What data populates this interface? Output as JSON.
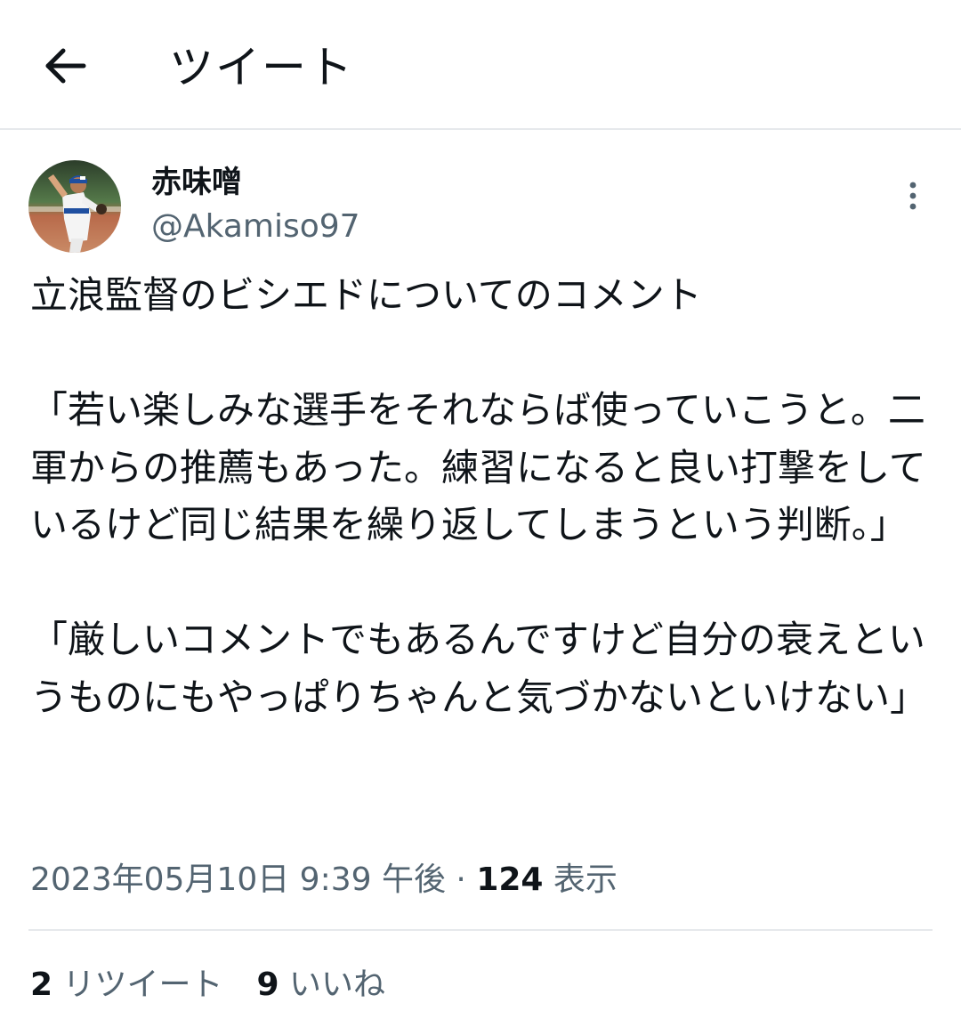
{
  "header": {
    "back_icon": "arrow-left-icon",
    "title": "ツイート"
  },
  "author": {
    "display_name": "赤味噌",
    "handle": "@Akamiso97",
    "avatar_icon": "baseball-pitcher-photo"
  },
  "more_icon": "vertical-ellipsis-icon",
  "tweet": {
    "text": "立浪監督のビシエドについてのコメント\n\n「若い楽しみな選手をそれならば使っていこうと。二軍からの推薦もあった。練習になると良い打撃をしているけど同じ結果を繰り返してしまうという判断。」\n\n「厳しいコメントでもあるんですけど自分の衰えというものにもやっぱりちゃんと気づかないといけない」"
  },
  "meta": {
    "timestamp": "2023年05月10日 9:39 午後",
    "separator": " · ",
    "views_count": "124",
    "views_label": " 表示"
  },
  "stats": {
    "retweets_count": "2",
    "retweets_label": " リツイート",
    "likes_count": "9",
    "likes_label": " いいね"
  },
  "colors": {
    "text_primary": "#0f1419",
    "text_secondary": "#536471",
    "divider": "#e6e9ec"
  }
}
